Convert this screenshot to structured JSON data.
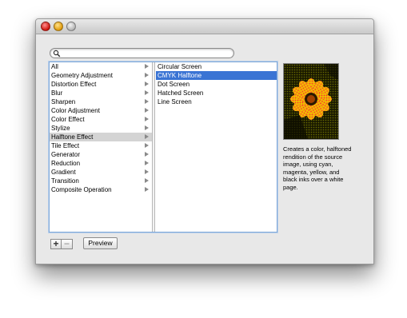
{
  "window": {
    "title": ""
  },
  "search": {
    "value": "",
    "placeholder": ""
  },
  "categories": [
    {
      "label": "All",
      "has_children": true
    },
    {
      "label": "Geometry Adjustment",
      "has_children": true
    },
    {
      "label": "Distortion Effect",
      "has_children": true
    },
    {
      "label": "Blur",
      "has_children": true
    },
    {
      "label": "Sharpen",
      "has_children": true
    },
    {
      "label": "Color Adjustment",
      "has_children": true
    },
    {
      "label": "Color Effect",
      "has_children": true
    },
    {
      "label": "Stylize",
      "has_children": true
    },
    {
      "label": "Halftone Effect",
      "has_children": true,
      "selected": true
    },
    {
      "label": "Tile Effect",
      "has_children": true
    },
    {
      "label": "Generator",
      "has_children": true
    },
    {
      "label": "Reduction",
      "has_children": true
    },
    {
      "label": "Gradient",
      "has_children": true
    },
    {
      "label": "Transition",
      "has_children": true
    },
    {
      "label": "Composite Operation",
      "has_children": true
    }
  ],
  "filters": [
    {
      "label": "Circular Screen"
    },
    {
      "label": "CMYK Halftone",
      "selected": true
    },
    {
      "label": "Dot Screen"
    },
    {
      "label": "Hatched Screen"
    },
    {
      "label": "Line Screen"
    }
  ],
  "description": "Creates a color, halftoned rendition of the source image, using cyan, magenta, yellow, and black inks over a white page.",
  "buttons": {
    "add": "+",
    "remove": "−",
    "preview": "Preview"
  },
  "colors": {
    "selection_blue": "#3a74d4",
    "selection_gray": "#d4d4d4",
    "close": "#d0140b",
    "minimize": "#e09a0a",
    "zoom": "#b4b4b4"
  },
  "icons": {
    "search": "magnifier-icon",
    "disclosure": "triangle-right-icon"
  }
}
